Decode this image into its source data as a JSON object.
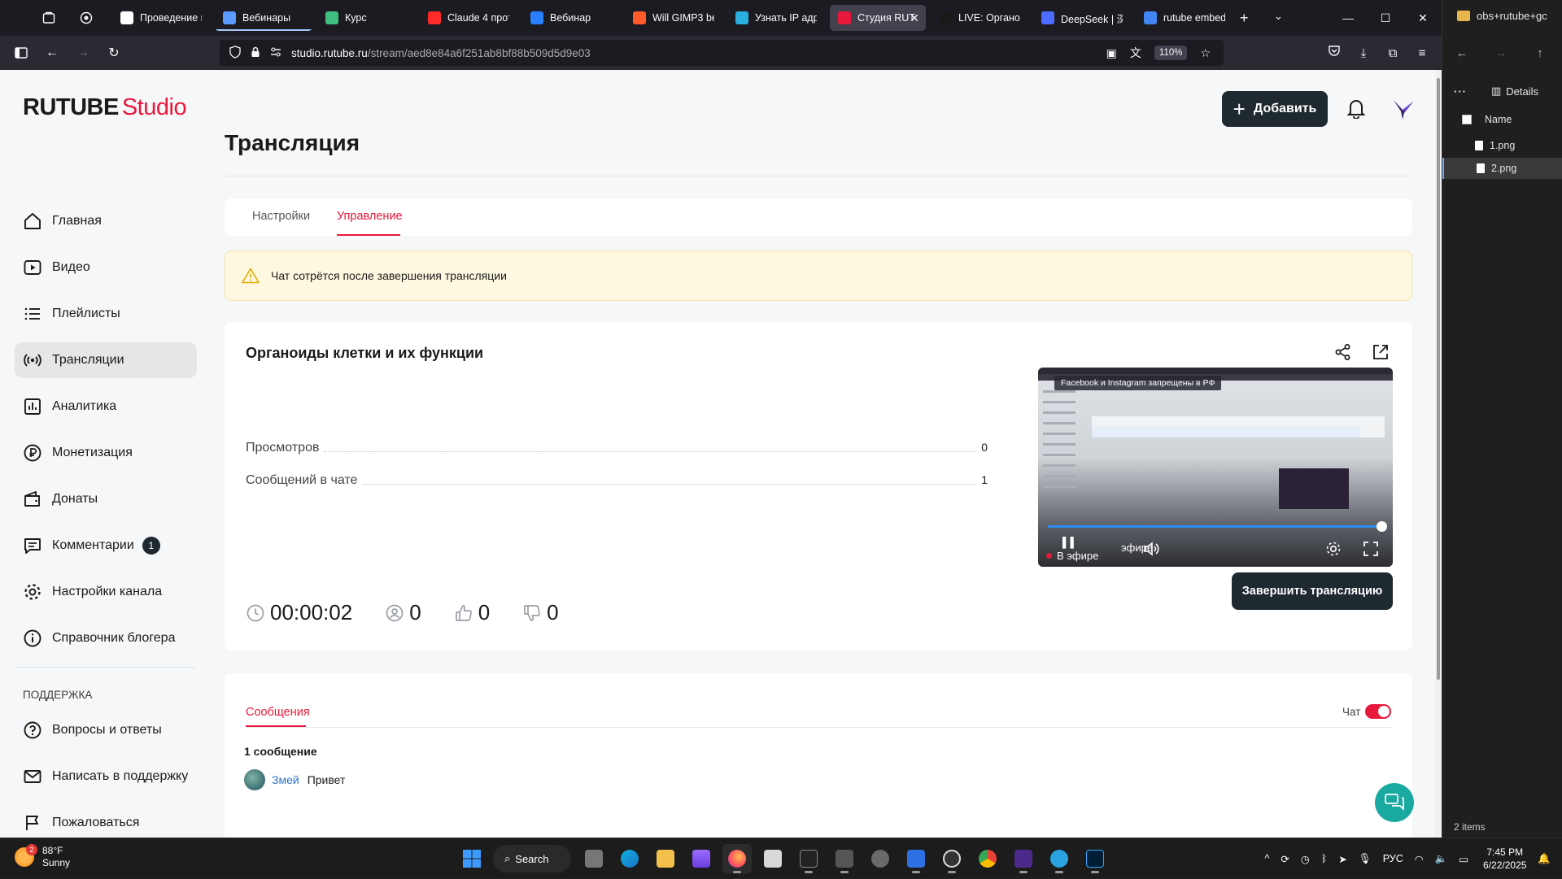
{
  "browser": {
    "tabs": [
      {
        "label": "Проведение в",
        "color": "#ffffff",
        "active": false
      },
      {
        "label": "Вебинары",
        "color": "#5b9bff",
        "active": false
      },
      {
        "label": "Курс",
        "color": "#3fbf7f",
        "active": false
      },
      {
        "label": "Claude 4 прот",
        "color": "#ff2a2a",
        "active": false
      },
      {
        "label": "Вебинар",
        "color": "#2a7fff",
        "active": false
      },
      {
        "label": "Will GIMP3 be",
        "color": "#ff5a2a",
        "active": false
      },
      {
        "label": "Узнать IP адре",
        "color": "#2ab0e0",
        "active": false
      },
      {
        "label": "Студия RUT",
        "color": "#e8183c",
        "active": true
      },
      {
        "label": "LIVE: Органо",
        "color": "#1a1a1a",
        "active": false
      },
      {
        "label": "DeepSeek | 深",
        "color": "#4d6bfe",
        "active": false
      },
      {
        "label": "rutube embed",
        "color": "#4285f4",
        "active": false
      }
    ],
    "url_host": "studio.rutube.ru",
    "url_path": "/stream/aed8e84a6f251ab8bf88b509d5d9e03",
    "zoom": "110%"
  },
  "header": {
    "logo_main": "RUTUBE",
    "logo_studio": "Studio",
    "add_label": "Добавить"
  },
  "sidebar": {
    "items": [
      {
        "label": "Главная",
        "icon": "home-icon"
      },
      {
        "label": "Видео",
        "icon": "video-icon"
      },
      {
        "label": "Плейлисты",
        "icon": "playlist-icon"
      },
      {
        "label": "Трансляции",
        "icon": "broadcast-icon",
        "active": true
      },
      {
        "label": "Аналитика",
        "icon": "analytics-icon"
      },
      {
        "label": "Монетизация",
        "icon": "ruble-icon"
      },
      {
        "label": "Донаты",
        "icon": "wallet-icon"
      },
      {
        "label": "Комментарии",
        "icon": "comment-icon",
        "badge": "1"
      },
      {
        "label": "Настройки канала",
        "icon": "gear-icon"
      },
      {
        "label": "Справочник блогера",
        "icon": "info-icon"
      }
    ],
    "support_heading": "ПОДДЕРЖКА",
    "support_items": [
      {
        "label": "Вопросы и ответы",
        "icon": "question-icon"
      },
      {
        "label": "Написать в поддержку",
        "icon": "mail-icon"
      },
      {
        "label": "Пожаловаться",
        "icon": "flag-icon"
      }
    ]
  },
  "main": {
    "page_title": "Трансляция",
    "tabs": [
      "Настройки",
      "Управление"
    ],
    "active_tab": "Управление",
    "warning": "Чат сотрётся после завершения трансляции",
    "stream": {
      "title": "Органоиды клетки и их функции",
      "views_label": "Просмотров",
      "views_value": "0",
      "chat_label": "Сообщений в чате",
      "chat_value": "1",
      "duration": "00:00:02",
      "viewers": "0",
      "likes": "0",
      "dislikes": "0",
      "end_label": "Завершить трансляцию",
      "player": {
        "banner": "Facebook и Instagram запрещены в РФ",
        "live_label": "В эфире",
        "live_label_2": "эфире",
        "progress": 1.0
      }
    },
    "chat": {
      "tab_label": "Сообщения",
      "toggle_label": "Чат",
      "toggle_on": true,
      "count_label": "1 сообщение",
      "messages": [
        {
          "author": "Змей",
          "text": "Привет"
        }
      ]
    }
  },
  "explorer": {
    "title": "obs+rutube+gc",
    "details_label": "Details",
    "column_name": "Name",
    "files": [
      {
        "name": "1.png",
        "selected": false
      },
      {
        "name": "2.png",
        "selected": true
      }
    ],
    "status": "2 items"
  },
  "taskbar": {
    "weather_temp": "88°F",
    "weather_desc": "Sunny",
    "weather_badge": "2",
    "search_label": "Search",
    "lang": "РУС",
    "time": "7:45 PM",
    "date": "6/22/2025"
  }
}
